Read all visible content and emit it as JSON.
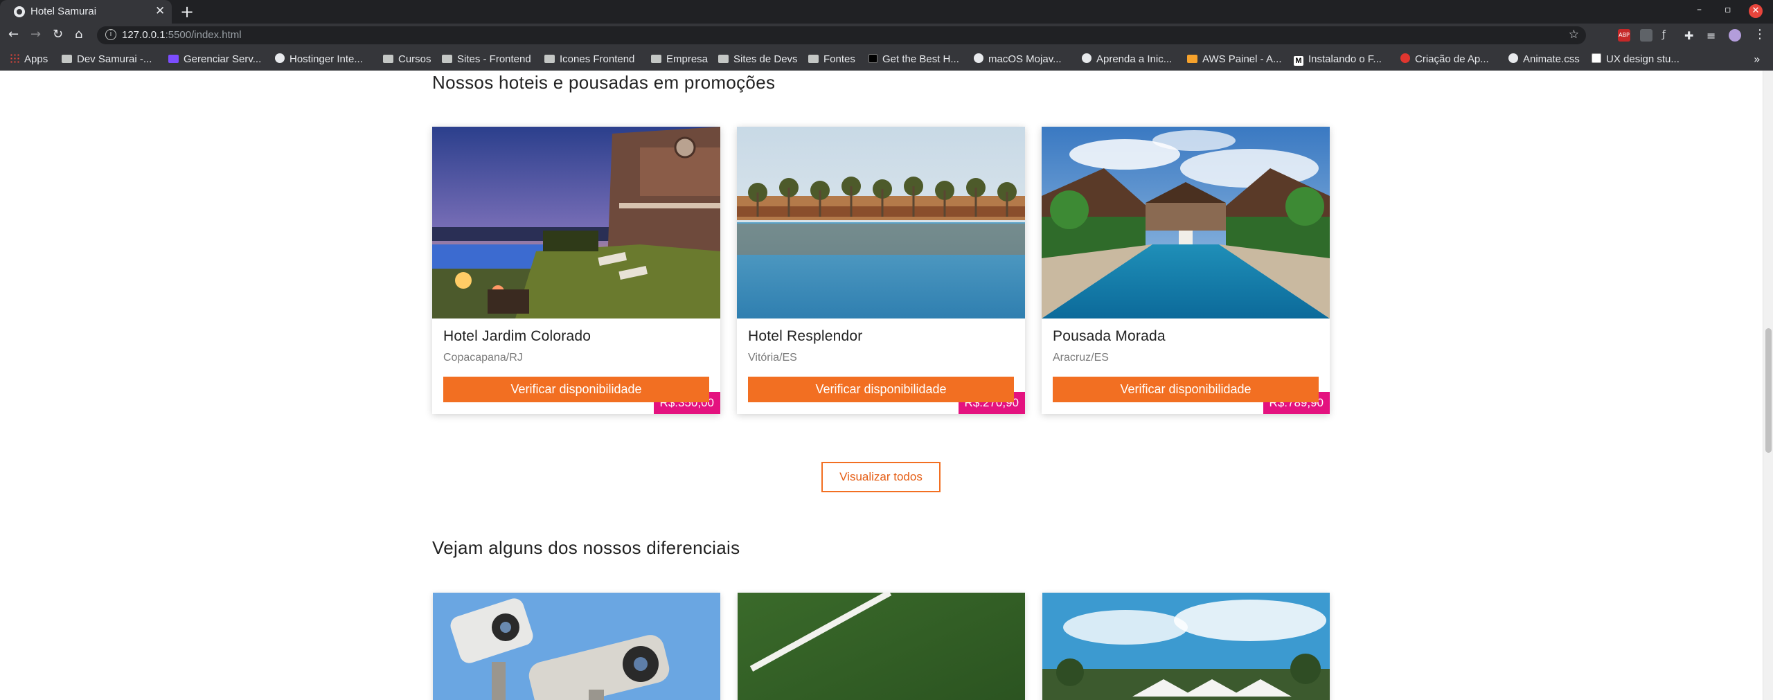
{
  "browser": {
    "tab_title": "Hotel Samurai",
    "url_host": "127.0.0.1",
    "url_rest": ":5500/index.html",
    "bookmarks": [
      {
        "label": "Apps",
        "icon": "apps-grid-icon"
      },
      {
        "label": "Dev Samurai -...",
        "icon": "folder-icon"
      },
      {
        "label": "Gerenciar Serv...",
        "icon": "hostinger-icon"
      },
      {
        "label": "Hostinger Inte...",
        "icon": "globe-icon"
      },
      {
        "label": "Cursos",
        "icon": "folder-icon"
      },
      {
        "label": "Sites - Frontend",
        "icon": "folder-icon"
      },
      {
        "label": "Icones Frontend",
        "icon": "folder-icon"
      },
      {
        "label": "Empresa",
        "icon": "folder-icon"
      },
      {
        "label": "Sites de Devs",
        "icon": "folder-icon"
      },
      {
        "label": "Fontes",
        "icon": "folder-icon"
      },
      {
        "label": "Get the Best H...",
        "icon": "dark-square-icon"
      },
      {
        "label": "macOS Mojav...",
        "icon": "globe-icon"
      },
      {
        "label": "Aprenda a Inic...",
        "icon": "globe-icon"
      },
      {
        "label": "AWS Painel - A...",
        "icon": "aws-icon"
      },
      {
        "label": "Instalando o F...",
        "icon": "medium-icon"
      },
      {
        "label": "Criação de Ap...",
        "icon": "red-logo-icon"
      },
      {
        "label": "Animate.css",
        "icon": "globe-icon"
      },
      {
        "label": "UX design stu...",
        "icon": "ux-icon"
      }
    ]
  },
  "promo": {
    "title": "Nossos hoteis e pousadas em promoções",
    "cards": [
      {
        "price": "R$:350,00",
        "name": "Hotel Jardim Colorado",
        "location": "Copacapana/RJ",
        "button": "Verificar disponibilidade"
      },
      {
        "price": "R$:270,90",
        "name": "Hotel Resplendor",
        "location": "Vitória/ES",
        "button": "Verificar disponibilidade"
      },
      {
        "price": "R$:789,90",
        "name": "Pousada Morada",
        "location": "Aracruz/ES",
        "button": "Verificar disponibilidade"
      }
    ],
    "view_all": "Visualizar todos"
  },
  "features": {
    "title": "Vejam alguns dos nossos diferenciais"
  },
  "colors": {
    "accent_orange": "#f26f22",
    "price_pink": "#e4127f"
  }
}
